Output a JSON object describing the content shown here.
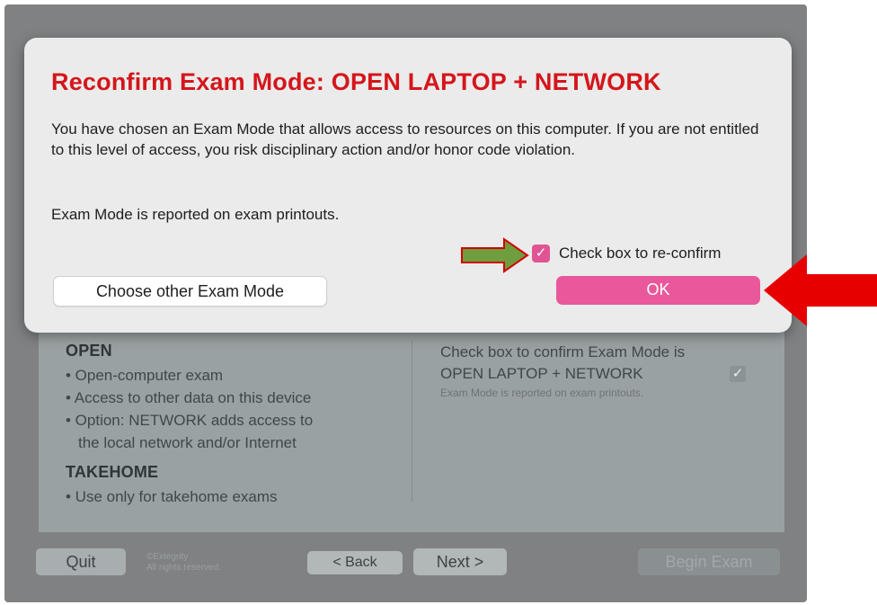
{
  "modal": {
    "title": "Reconfirm Exam Mode: OPEN LAPTOP + NETWORK",
    "body": "You have chosen an Exam Mode that allows access to resources on this computer. If you are not entitled to this level of access, you risk disciplinary action and/or honor code violation.",
    "note": "Exam Mode is reported on exam printouts.",
    "reconfirm_label": "Check box to re-confirm",
    "reconfirm_checked": true,
    "choose_button": "Choose other Exam Mode",
    "ok_button": "OK"
  },
  "background": {
    "open": {
      "title": "OPEN",
      "bullets": [
        "• Open-computer exam",
        "• Access to other data on this device",
        "• Option: NETWORK adds access to",
        "the local network and/or Internet"
      ]
    },
    "takehome": {
      "title": "TAKEHOME",
      "bullets": [
        "• Use only for takehome exams"
      ]
    },
    "confirm_line1": "Check box to confirm Exam Mode is",
    "confirm_line2": "OPEN LAPTOP + NETWORK",
    "confirm_checked": true,
    "confirm_note": "Exam Mode is reported on exam printouts."
  },
  "footer": {
    "quit": "Quit",
    "copyright_line1": "©Extegrity",
    "copyright_line2": "All rights reserved.",
    "back": "< Back",
    "next": "Next >",
    "begin": "Begin Exam"
  },
  "colors": {
    "title_red": "#d4161b",
    "accent_pink": "#e8589a",
    "arrow_green": "#6e9e3e",
    "arrow_red": "#e60000"
  },
  "icons": {
    "checkmark": "check-icon"
  }
}
